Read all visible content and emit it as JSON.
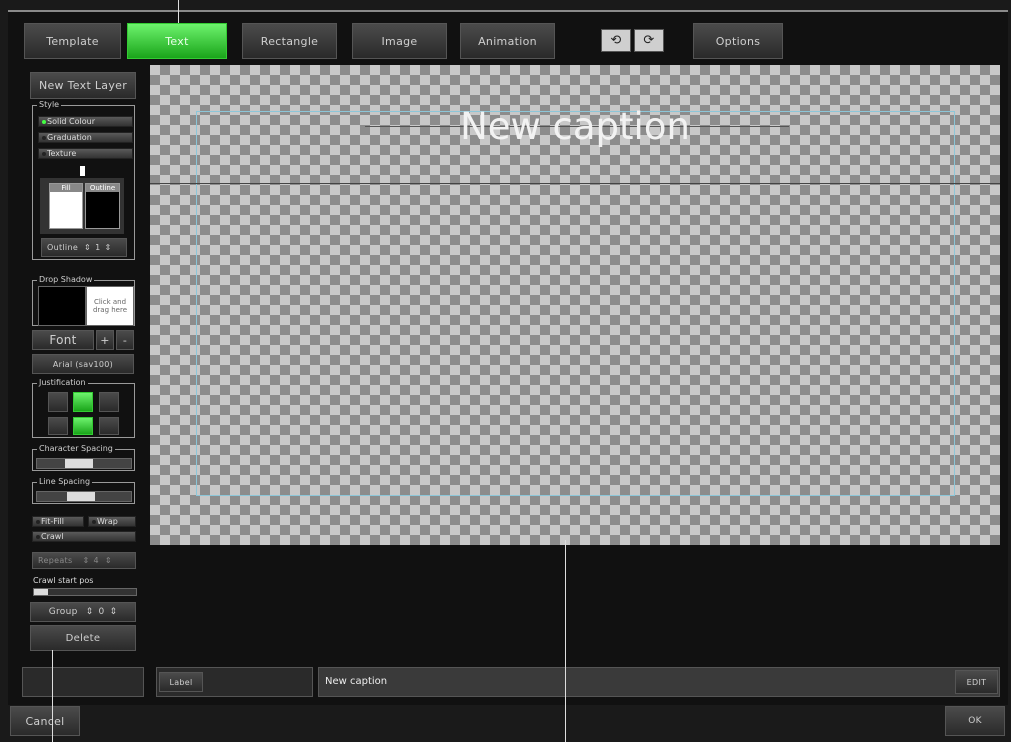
{
  "toolbar": {
    "tabs": [
      {
        "label": "Template"
      },
      {
        "label": "Text"
      },
      {
        "label": "Rectangle"
      },
      {
        "label": "Image"
      },
      {
        "label": "Animation"
      }
    ],
    "options_label": "Options"
  },
  "side": {
    "new_text_layer": "New Text Layer",
    "style_title": "Style",
    "style_options": [
      "Solid Colour",
      "Graduation",
      "Texture"
    ],
    "fill_label": "Fill",
    "outline_label": "Outline",
    "outline_stepper_label": "Outline",
    "outline_value": "1",
    "drop_shadow_title": "Drop Shadow",
    "drop_shadow_hint": "Click and drag here",
    "font_label": "Font",
    "font_plus": "+",
    "font_minus": "-",
    "font_name": "Arial (sav100)",
    "justification_title": "Justification",
    "char_spacing_title": "Character Spacing",
    "line_spacing_title": "Line Spacing",
    "fit_fill": "Fit-Fill",
    "wrap": "Wrap",
    "crawl": "Crawl",
    "repeats_label": "Repeats",
    "repeats_value": "4",
    "crawl_start_pos": "Crawl start pos",
    "group_label": "Group",
    "group_value": "0",
    "delete_label": "Delete"
  },
  "canvas": {
    "caption": "New caption"
  },
  "bottom": {
    "label_tag": "Label",
    "caption_value": "New caption",
    "edit_label": "EDIT",
    "cancel_label": "Cancel",
    "ok_label": "OK"
  }
}
